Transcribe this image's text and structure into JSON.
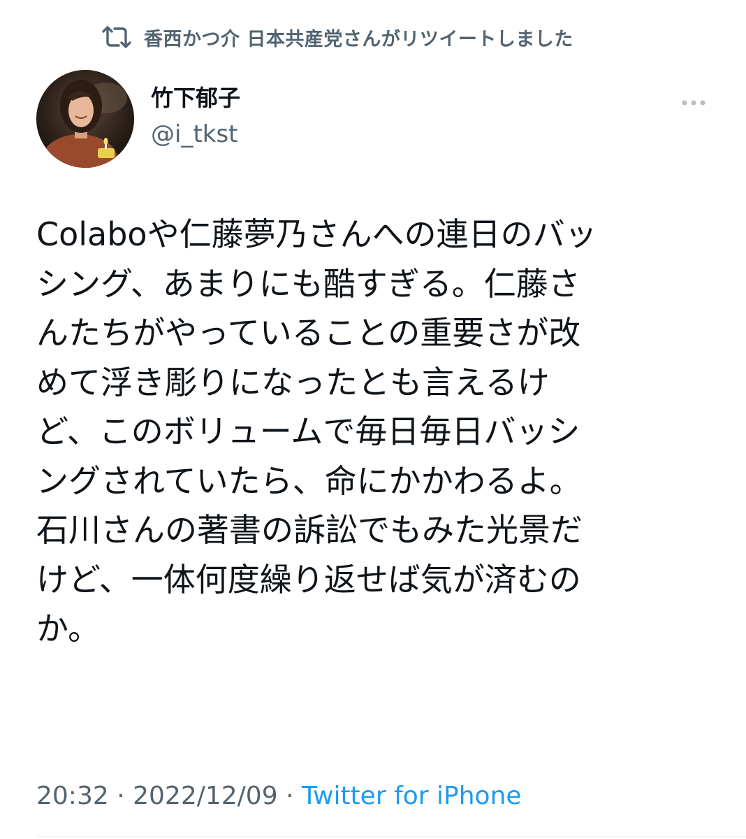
{
  "retweet": {
    "icon": "retweet-icon",
    "text": "香西かつ介 日本共産党さんがリツイートしました"
  },
  "author": {
    "display_name": "竹下郁子",
    "handle": "@i_tkst",
    "avatar_icon": "profile-photo"
  },
  "more_icon": "more-options-icon",
  "tweet": {
    "lines": [
      "Colaboや仁藤夢乃さんへの連日のバッ",
      "シング、あまりにも酷すぎる。仁藤さ",
      "んたちがやっていることの重要さが改",
      "めて浮き彫りになったとも言えるけ",
      "ど、このボリュームで毎日毎日バッシ",
      "ングされていたら、命にかかわるよ。",
      "石川さんの著書の訴訟でもみた光景だ",
      "けど、一体何度繰り返せば気が済むの",
      "か。"
    ]
  },
  "meta": {
    "time": "20:32",
    "separator": "·",
    "date": "2022/12/09",
    "source": "Twitter for iPhone"
  },
  "colors": {
    "text": "#0f1419",
    "secondary": "#536471",
    "link": "#1d9bf0"
  }
}
